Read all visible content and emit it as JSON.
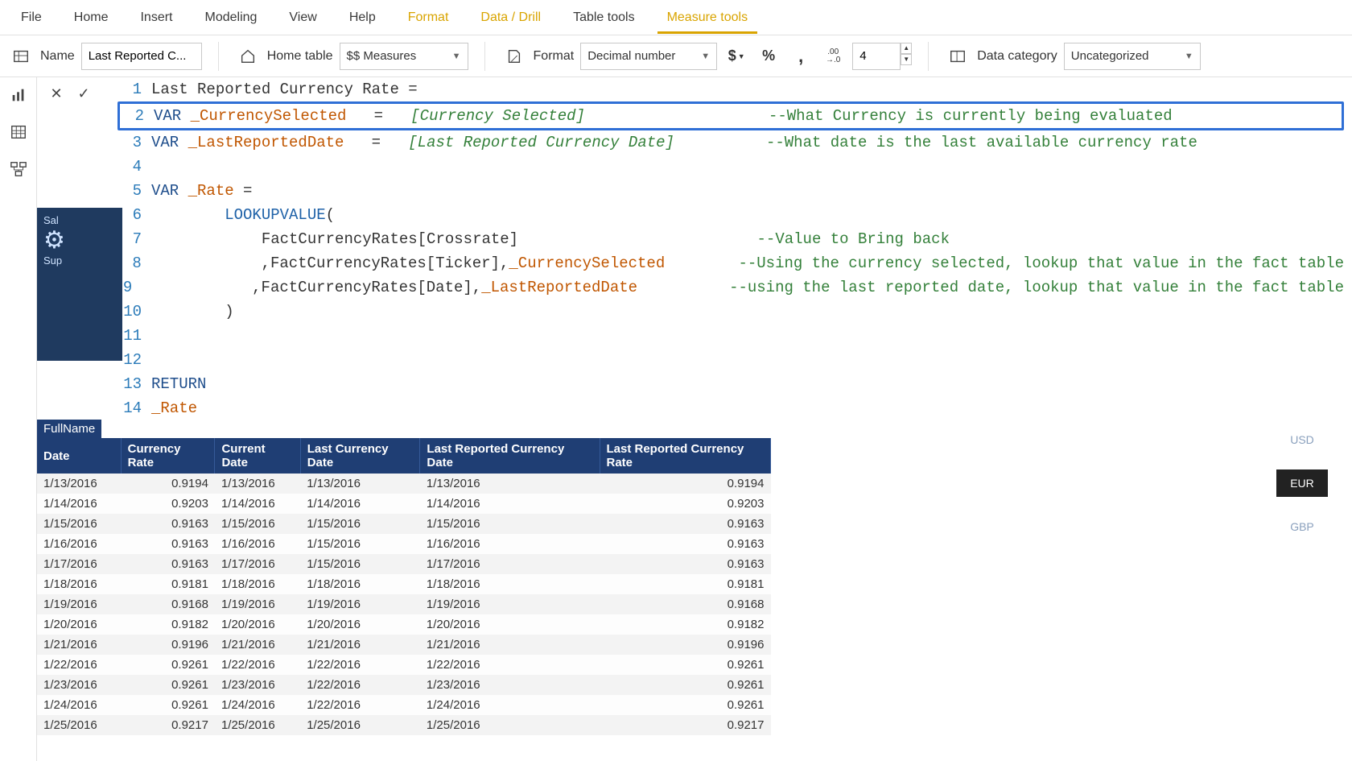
{
  "menu": [
    "File",
    "Home",
    "Insert",
    "Modeling",
    "View",
    "Help",
    "Format",
    "Data / Drill",
    "Table tools",
    "Measure tools"
  ],
  "menu_highlight": [
    6,
    7
  ],
  "menu_active": 9,
  "ribbon": {
    "name_label": "Name",
    "name_value": "Last Reported C...",
    "home_label": "Home table",
    "home_value": "$$ Measures",
    "format_label": "Format",
    "format_value": "Decimal number",
    "decimals": "4",
    "category_label": "Data category",
    "category_value": "Uncategorized"
  },
  "code": {
    "lines": [
      {
        "n": 1,
        "segs": [
          {
            "t": "Last Reported Currency Rate ="
          }
        ]
      },
      {
        "n": 2,
        "hl": true,
        "segs": [
          {
            "t": "VAR ",
            "c": "kw-var"
          },
          {
            "t": "_CurrencySelected",
            "c": "ident"
          },
          {
            "t": "   =   "
          },
          {
            "t": "[Currency Selected]",
            "c": "ref"
          },
          {
            "t": "                    "
          },
          {
            "t": "--What Currency is currently being evaluated",
            "c": "comment"
          }
        ]
      },
      {
        "n": 3,
        "segs": [
          {
            "t": "VAR ",
            "c": "kw-var"
          },
          {
            "t": "_LastReportedDate",
            "c": "ident"
          },
          {
            "t": "   =   "
          },
          {
            "t": "[Last Reported Currency Date]",
            "c": "ref"
          },
          {
            "t": "          "
          },
          {
            "t": "--What date is the last available currency rate",
            "c": "comment"
          }
        ]
      },
      {
        "n": 4,
        "segs": [
          {
            "t": " "
          }
        ]
      },
      {
        "n": 5,
        "segs": [
          {
            "t": "VAR ",
            "c": "kw-var"
          },
          {
            "t": "_Rate",
            "c": "ident"
          },
          {
            "t": " ="
          }
        ]
      },
      {
        "n": 6,
        "segs": [
          {
            "t": "        "
          },
          {
            "t": "LOOKUPVALUE",
            "c": "func"
          },
          {
            "t": "("
          }
        ]
      },
      {
        "n": 7,
        "segs": [
          {
            "t": "            FactCurrencyRates[Crossrate]"
          },
          {
            "t": "                          "
          },
          {
            "t": "--Value to Bring back",
            "c": "comment"
          }
        ]
      },
      {
        "n": 8,
        "segs": [
          {
            "t": "            ,FactCurrencyRates[Ticker],"
          },
          {
            "t": "_CurrencySelected",
            "c": "ident"
          },
          {
            "t": "        "
          },
          {
            "t": "--Using the currency selected, lookup that value in the fact table",
            "c": "comment"
          }
        ]
      },
      {
        "n": 9,
        "segs": [
          {
            "t": "            ,FactCurrencyRates[Date],"
          },
          {
            "t": "_LastReportedDate",
            "c": "ident"
          },
          {
            "t": "          "
          },
          {
            "t": "--using the last reported date, lookup that value in the fact table",
            "c": "comment"
          }
        ]
      },
      {
        "n": 10,
        "segs": [
          {
            "t": "        )"
          }
        ]
      },
      {
        "n": 11,
        "segs": [
          {
            "t": " "
          }
        ]
      },
      {
        "n": 12,
        "segs": [
          {
            "t": " "
          }
        ]
      },
      {
        "n": 13,
        "segs": [
          {
            "t": "RETURN",
            "c": "kw-ret"
          }
        ]
      },
      {
        "n": 14,
        "segs": [
          {
            "t": "_Rate",
            "c": "ident"
          }
        ]
      }
    ]
  },
  "thumb": {
    "line1": " Sal",
    "line2": "Sup"
  },
  "table": {
    "fullname": "FullName",
    "headers": [
      "Date",
      "Currency Rate",
      "Current Date",
      "Last Currency Date",
      "Last Reported Currency Date",
      "Last Reported Currency Rate"
    ],
    "rows": [
      [
        "1/13/2016",
        "0.9194",
        "1/13/2016",
        "1/13/2016",
        "1/13/2016",
        "0.9194"
      ],
      [
        "1/14/2016",
        "0.9203",
        "1/14/2016",
        "1/14/2016",
        "1/14/2016",
        "0.9203"
      ],
      [
        "1/15/2016",
        "0.9163",
        "1/15/2016",
        "1/15/2016",
        "1/15/2016",
        "0.9163"
      ],
      [
        "1/16/2016",
        "0.9163",
        "1/16/2016",
        "1/15/2016",
        "1/16/2016",
        "0.9163"
      ],
      [
        "1/17/2016",
        "0.9163",
        "1/17/2016",
        "1/15/2016",
        "1/17/2016",
        "0.9163"
      ],
      [
        "1/18/2016",
        "0.9181",
        "1/18/2016",
        "1/18/2016",
        "1/18/2016",
        "0.9181"
      ],
      [
        "1/19/2016",
        "0.9168",
        "1/19/2016",
        "1/19/2016",
        "1/19/2016",
        "0.9168"
      ],
      [
        "1/20/2016",
        "0.9182",
        "1/20/2016",
        "1/20/2016",
        "1/20/2016",
        "0.9182"
      ],
      [
        "1/21/2016",
        "0.9196",
        "1/21/2016",
        "1/21/2016",
        "1/21/2016",
        "0.9196"
      ],
      [
        "1/22/2016",
        "0.9261",
        "1/22/2016",
        "1/22/2016",
        "1/22/2016",
        "0.9261"
      ],
      [
        "1/23/2016",
        "0.9261",
        "1/23/2016",
        "1/22/2016",
        "1/23/2016",
        "0.9261"
      ],
      [
        "1/24/2016",
        "0.9261",
        "1/24/2016",
        "1/22/2016",
        "1/24/2016",
        "0.9261"
      ],
      [
        "1/25/2016",
        "0.9217",
        "1/25/2016",
        "1/25/2016",
        "1/25/2016",
        "0.9217"
      ]
    ]
  },
  "slicer": {
    "items": [
      "USD",
      "EUR",
      "GBP"
    ],
    "selected": 1
  }
}
